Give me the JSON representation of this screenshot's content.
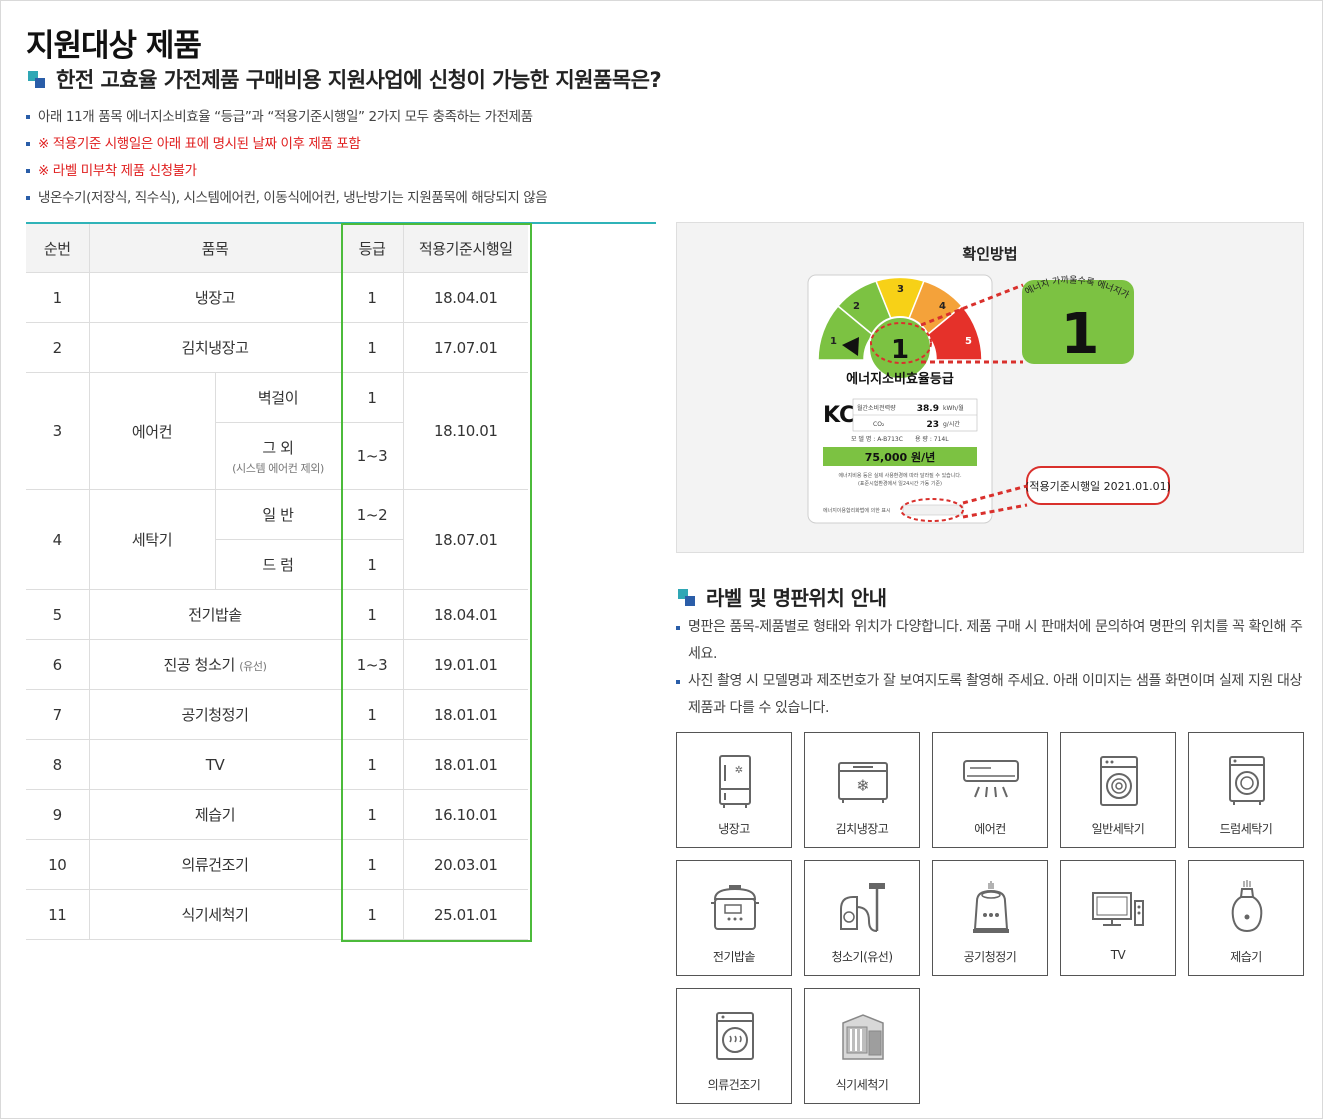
{
  "title": "지원대상 제품",
  "subtitle": "한전 고효율 가전제품 구매비용 지원사업에 신청이 가능한 지원품목은?",
  "notes": [
    "아래 11개 품목 에너지소비효율 “등급”과 “적용기준시행일” 2가지 모두 충족하는 가전제품",
    "※ 적용기준 시행일은 아래 표에 명시된 날짜 이후 제품 포함",
    "※ 라벨 미부착 제품 신청불가",
    "냉온수기(저장식, 직수식), 시스템에어컨, 이동식에어컨, 냉난방기는 지원품목에 해당되지 않음"
  ],
  "table": {
    "headers": [
      "순번",
      "품목",
      "등급",
      "적용기준시행일"
    ],
    "rows": [
      {
        "no": "1",
        "item": "냉장고",
        "grade": "1",
        "date": "18.04.01"
      },
      {
        "no": "2",
        "item": "김치냉장고",
        "grade": "1",
        "date": "17.07.01"
      },
      {
        "no": "3",
        "item": "에어컨",
        "subs": [
          {
            "name": "벽걸이",
            "grade": "1"
          },
          {
            "name": "그 외",
            "note": "(시스템 에어컨 제외)",
            "grade": "1~3"
          }
        ],
        "date": "18.10.01"
      },
      {
        "no": "4",
        "item": "세탁기",
        "subs": [
          {
            "name": "일 반",
            "grade": "1~2"
          },
          {
            "name": "드 럼",
            "grade": "1"
          }
        ],
        "date": "18.07.01"
      },
      {
        "no": "5",
        "item": "전기밥솥",
        "grade": "1",
        "date": "18.04.01"
      },
      {
        "no": "6",
        "item": "진공 청소기",
        "note": "(유선)",
        "grade": "1~3",
        "date": "19.01.01"
      },
      {
        "no": "7",
        "item": "공기청정기",
        "grade": "1",
        "date": "18.01.01"
      },
      {
        "no": "8",
        "item": "TV",
        "grade": "1",
        "date": "18.01.01"
      },
      {
        "no": "9",
        "item": "제습기",
        "grade": "1",
        "date": "16.10.01"
      },
      {
        "no": "10",
        "item": "의류건조기",
        "grade": "1",
        "date": "20.03.01"
      },
      {
        "no": "11",
        "item": "식기세척기",
        "grade": "1",
        "date": "25.01.01"
      }
    ]
  },
  "confirm": {
    "title": "확인방법",
    "label": {
      "gauge_numbers": [
        "1",
        "2",
        "3",
        "4",
        "5"
      ],
      "grade": "1",
      "zoom_arc_text": "에너지 가까울수록 에너지가 절약",
      "name": "에너지소비효율등급",
      "rows": [
        {
          "label": "월간소비전력량",
          "value": "38.9",
          "unit": "kWh/월"
        },
        {
          "label": "CO₂",
          "value": "23",
          "unit": "g/시간"
        }
      ],
      "model": "모 델 명 : A-B713C",
      "capacity": "용 량 : 714L",
      "cost": "75,000 원/년",
      "fine1": "에너지비용 등은 실제 사용환경에 따라 달라질 수 있습니다.",
      "fine2": "(표준시험환경에서 일24시간 가동 기준)",
      "footer": "에너지이용합리화법에 의한 표시",
      "callout": "(적용기준시행일 2021.01.01)"
    },
    "colors": {
      "green": "#7cc242",
      "yellow": "#f7d117",
      "orange": "#f4a23a",
      "red": "#e5312a",
      "callout": "#d9302c"
    }
  },
  "section2": {
    "title": "라벨 및 명판위치 안내",
    "notes": [
      "명판은 품목-제품별로 형태와 위치가 다양합니다. 제품 구매 시 판매처에 문의하여 명판의 위치를 꼭 확인해 주세요.",
      "사진 촬영 시 모델명과 제조번호가 잘 보여지도록 촬영해 주세요. 아래 이미지는 샘플 화면이며 실제 지원 대상 제품과 다를 수 있습니다."
    ]
  },
  "products": [
    {
      "label": "냉장고",
      "icon": "refrigerator-icon"
    },
    {
      "label": "김치냉장고",
      "icon": "kimchi-refrigerator-icon"
    },
    {
      "label": "에어컨",
      "icon": "air-conditioner-icon"
    },
    {
      "label": "일반세탁기",
      "icon": "top-load-washer-icon"
    },
    {
      "label": "드럼세탁기",
      "icon": "drum-washer-icon"
    },
    {
      "label": "전기밥솥",
      "icon": "rice-cooker-icon"
    },
    {
      "label": "청소기(유선)",
      "icon": "vacuum-cleaner-icon"
    },
    {
      "label": "공기청정기",
      "icon": "air-purifier-icon"
    },
    {
      "label": "TV",
      "icon": "tv-icon"
    },
    {
      "label": "제습기",
      "icon": "dehumidifier-icon"
    },
    {
      "label": "의류건조기",
      "icon": "clothes-dryer-icon"
    },
    {
      "label": "식기세척기",
      "icon": "dishwasher-icon"
    }
  ]
}
